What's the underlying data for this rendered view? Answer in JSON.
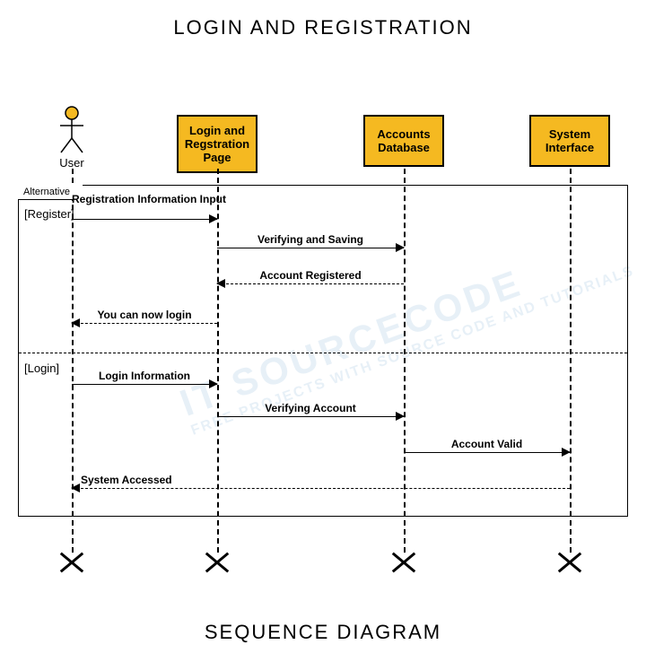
{
  "title": "LOGIN AND REGISTRATION",
  "footer": "SEQUENCE DIAGRAM",
  "watermark": {
    "main": "IT SOURCECODE",
    "sub": "FREE PROJECTS WITH SOURCE CODE AND TUTORIALS"
  },
  "actor": {
    "label": "User"
  },
  "lifelines": {
    "page": "Login and Regstration Page",
    "db": "Accounts Database",
    "sys": "System Interface"
  },
  "frame": {
    "tab": "Alternative",
    "guard1": "[Register]",
    "guard2": "[Login]"
  },
  "messages": {
    "m1": "Registration Information Input",
    "m2": "Verifying and Saving",
    "m3": "Account Registered",
    "m4": "You can now login",
    "m5": "Login Information",
    "m6": "Verifying Account",
    "m7": "Account Valid",
    "m8": "System Accessed"
  }
}
